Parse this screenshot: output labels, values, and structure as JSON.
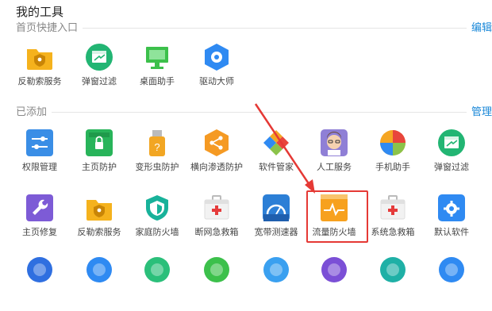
{
  "page_title": "我的工具",
  "section_quick": {
    "label": "首页快捷入口",
    "action": "编辑"
  },
  "section_added": {
    "label": "已添加",
    "action": "管理"
  },
  "quick_tools": [
    {
      "label": "反勒索服务",
      "icon": "shield-folder-icon",
      "color": "#f5b21d"
    },
    {
      "label": "弹窗过滤",
      "icon": "popup-filter-icon",
      "color": "#22b573"
    },
    {
      "label": "桌面助手",
      "icon": "monitor-icon",
      "color": "#3cc04b"
    },
    {
      "label": "驱动大师",
      "icon": "gear-cube-icon",
      "color": "#2f8af2"
    }
  ],
  "added_tools_row1": [
    {
      "label": "权限管理",
      "icon": "sliders-icon",
      "color": "#3a8ee6"
    },
    {
      "label": "主页防护",
      "icon": "lock-home-icon",
      "color": "#28b45a"
    },
    {
      "label": "变形虫防护",
      "icon": "usb-shield-icon",
      "color": "#f2a623"
    },
    {
      "label": "横向渗透防护",
      "icon": "share-hex-icon",
      "color": "#f59a23"
    },
    {
      "label": "软件管家",
      "icon": "colorful-blocks-icon",
      "color": "#e8453c"
    },
    {
      "label": "人工服务",
      "icon": "avatar-service-icon",
      "color": "#8f7fd6"
    },
    {
      "label": "手机助手",
      "icon": "color-ball-icon",
      "color": "#e9483f"
    },
    {
      "label": "弹窗过滤",
      "icon": "popup-filter-icon",
      "color": "#22b573"
    }
  ],
  "added_tools_row2": [
    {
      "label": "主页修复",
      "icon": "wrench-icon",
      "color": "#7d5bd6"
    },
    {
      "label": "反勒索服务",
      "icon": "shield-folder-icon",
      "color": "#f5b21d"
    },
    {
      "label": "家庭防火墙",
      "icon": "house-shield-icon",
      "color": "#18b29a"
    },
    {
      "label": "断网急救箱",
      "icon": "first-aid-icon",
      "color": "#e53b3b"
    },
    {
      "label": "宽带测速器",
      "icon": "speed-gauge-icon",
      "color": "#2c7fd6"
    },
    {
      "label": "流量防火墙",
      "icon": "firewall-pulse-icon",
      "color": "#f7a11e"
    },
    {
      "label": "系统急救箱",
      "icon": "first-aid-icon",
      "color": "#e53b3b"
    },
    {
      "label": "默认软件",
      "icon": "gear-window-icon",
      "color": "#2f8af2"
    }
  ],
  "added_tools_row3": [
    {
      "icon": "blue-tool-icon",
      "color": "#2f6fe0"
    },
    {
      "icon": "blue-window-icon",
      "color": "#2f8af2"
    },
    {
      "icon": "green-leaf-icon",
      "color": "#2bbf7a"
    },
    {
      "icon": "green-circle-icon",
      "color": "#3cc04b"
    },
    {
      "icon": "cloud-icon",
      "color": "#3aa0f0"
    },
    {
      "icon": "purple-orb-icon",
      "color": "#7b4fd6"
    },
    {
      "icon": "teal-ring-icon",
      "color": "#1fb0a6"
    },
    {
      "icon": "blue-disc-icon",
      "color": "#2f8af2"
    }
  ]
}
